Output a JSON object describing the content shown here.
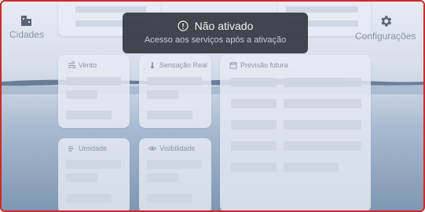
{
  "app": {
    "cities_label": "Cidades",
    "settings_label": "Configurações"
  },
  "cards": {
    "wind": {
      "title": "Vento"
    },
    "feels_like": {
      "title": "Sensação Real"
    },
    "forecast": {
      "title": "Previsão futura"
    },
    "humidity": {
      "title": "Umidade"
    },
    "visibility": {
      "title": "Visibilidade"
    }
  },
  "toast": {
    "title": "Não ativado",
    "message": "Acesso aos serviços após a ativação",
    "icon": "info-circle-icon"
  },
  "colors": {
    "border": "#cf2a2a",
    "toast_bg": "#343942",
    "skeleton": "#cdd5e2"
  }
}
